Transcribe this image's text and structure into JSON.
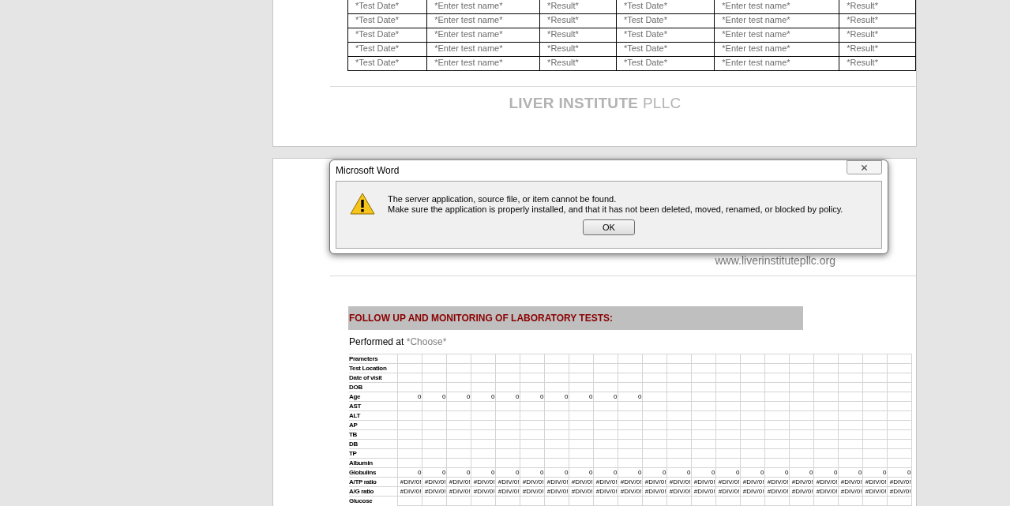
{
  "document": {
    "results_table": {
      "rows": [
        {
          "cells": [
            "*Test Date*",
            "*Enter test name*",
            "*Result*",
            "*Test Date*",
            "*Enter test name*",
            "*Result*"
          ]
        },
        {
          "cells": [
            "*Test Date*",
            "*Enter test name*",
            "*Result*",
            "*Test Date*",
            "*Enter test name*",
            "*Result*"
          ]
        },
        {
          "cells": [
            "*Test Date*",
            "*Enter test name*",
            "*Result*",
            "*Test Date*",
            "*Enter test name*",
            "*Result*"
          ]
        },
        {
          "cells": [
            "*Test Date*",
            "*Enter test name*",
            "*Result*",
            "*Test Date*",
            "*Enter test name*",
            "*Result*"
          ]
        },
        {
          "cells": [
            "*Test Date*",
            "*Enter test name*",
            "*Result*",
            "*Test Date*",
            "*Enter test name*",
            "*Result*"
          ]
        }
      ]
    },
    "footer_logo": {
      "name": "LIVER INSTITUTE",
      "suffix": "PLLC"
    },
    "header_website": "www.liverinstitutepllc.org",
    "section_heading": "FOLLOW UP AND MONITORING OF LABORATORY TESTS:",
    "performed_at": {
      "label": "Performed at",
      "value": "*Choose*"
    },
    "lab_sheet": {
      "rows": [
        {
          "label": "Prameters"
        },
        {
          "label": "Test Location"
        },
        {
          "label": "Date of visit"
        },
        {
          "label": "DOB"
        },
        {
          "label": "Age",
          "values": [
            "0",
            "0",
            "0",
            "0",
            "0",
            "0",
            "0",
            "0",
            "0",
            "0"
          ]
        },
        {
          "label": "AST"
        },
        {
          "label": "ALT"
        },
        {
          "label": "AP"
        },
        {
          "label": "TB"
        },
        {
          "label": "DB"
        },
        {
          "label": "TP"
        },
        {
          "label": "Albumin"
        },
        {
          "label": "Globulins",
          "values": [
            "0",
            "0",
            "0",
            "0",
            "0",
            "0",
            "0",
            "0",
            "0",
            "0",
            "0",
            "0",
            "0",
            "0",
            "0",
            "0",
            "0",
            "0",
            "0",
            "0",
            "0"
          ]
        },
        {
          "label": "A/TP ratio",
          "values": [
            "#DIV/0!",
            "#DIV/0!",
            "#DIV/0!",
            "#DIV/0!",
            "#DIV/0!",
            "#DIV/0!",
            "#DIV/0!",
            "#DIV/0!",
            "#DIV/0!",
            "#DIV/0!",
            "#DIV/0!",
            "#DIV/0!",
            "#DIV/0!",
            "#DIV/0!",
            "#DIV/0!",
            "#DIV/0!",
            "#DIV/0!",
            "#DIV/0!",
            "#DIV/0!",
            "#DIV/0!",
            "#DIV/0!"
          ]
        },
        {
          "label": "A/G ratio",
          "values": [
            "#DIV/0!",
            "#DIV/0!",
            "#DIV/0!",
            "#DIV/0!",
            "#DIV/0!",
            "#DIV/0!",
            "#DIV/0!",
            "#DIV/0!",
            "#DIV/0!",
            "#DIV/0!",
            "#DIV/0!",
            "#DIV/0!",
            "#DIV/0!",
            "#DIV/0!",
            "#DIV/0!",
            "#DIV/0!",
            "#DIV/0!",
            "#DIV/0!",
            "#DIV/0!",
            "#DIV/0!",
            "#DIV/0!"
          ]
        },
        {
          "label": "Glucose"
        }
      ]
    }
  },
  "dialog": {
    "title": "Microsoft Word",
    "message": [
      "The server application, source file, or item cannot be found.",
      "Make sure the application is properly installed, and that it has not been deleted, moved, renamed, or blocked by policy."
    ],
    "buttons": [
      "OK"
    ]
  }
}
